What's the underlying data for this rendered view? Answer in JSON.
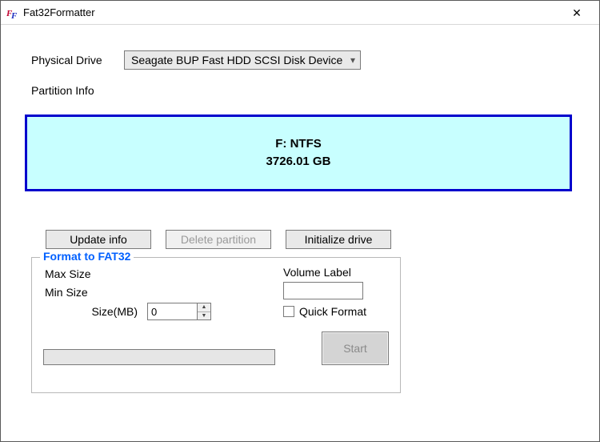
{
  "window": {
    "title": "Fat32Formatter"
  },
  "labels": {
    "physical_drive": "Physical Drive",
    "partition_info": "Partition Info"
  },
  "drive_select": {
    "selected": "Seagate BUP Fast HDD SCSI Disk Device"
  },
  "partition": {
    "line1": "F: NTFS",
    "line2": "3726.01 GB"
  },
  "buttons": {
    "update": "Update info",
    "delete": "Delete partition",
    "initialize": "Initialize drive",
    "start": "Start"
  },
  "groupbox": {
    "legend": "Format to FAT32",
    "max_size": "Max Size",
    "min_size": "Min Size",
    "size_mb": "Size(MB)",
    "volume_label": "Volume Label",
    "volume_value": "",
    "size_value": "0",
    "quick_format": "Quick Format"
  }
}
